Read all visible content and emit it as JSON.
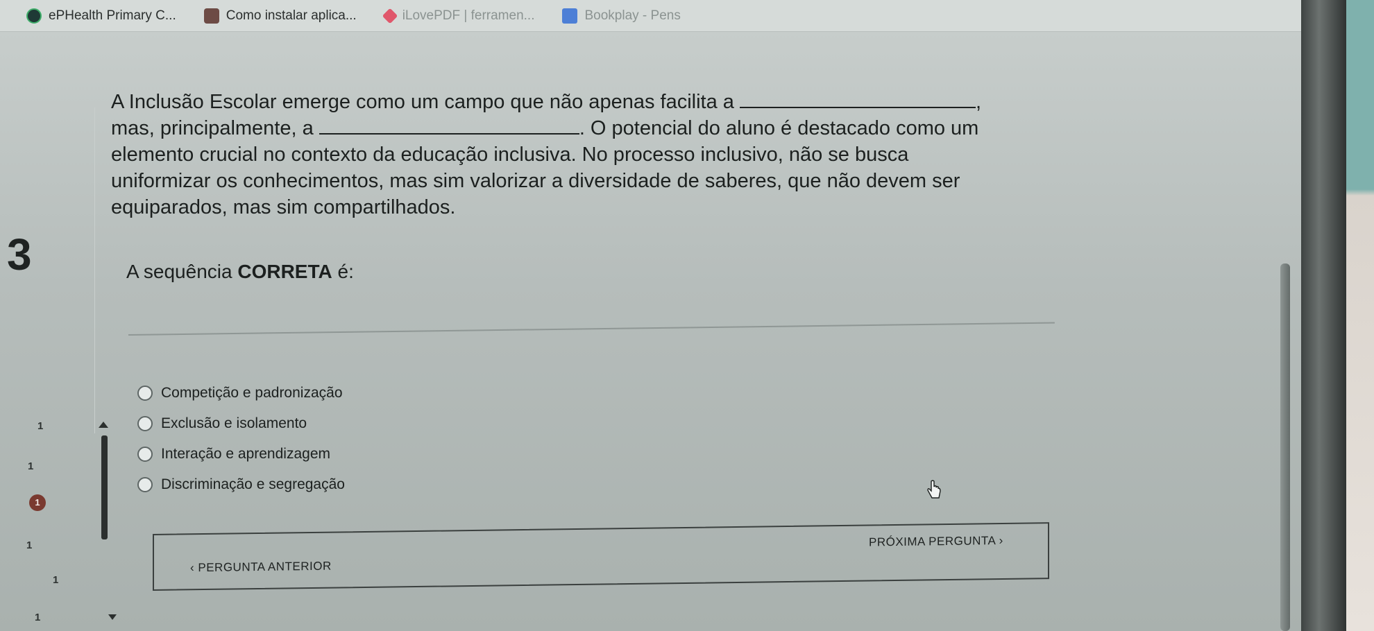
{
  "bookmarks": [
    {
      "label": "ePHealth Primary C...",
      "icon": "ephealth-icon"
    },
    {
      "label": "Como instalar aplica...",
      "icon": "como-icon"
    },
    {
      "label": "iLovePDF | ferramen...",
      "icon": "ilovepdf-icon"
    },
    {
      "label": "Bookplay - Pens",
      "icon": "bookplay-icon"
    }
  ],
  "question": {
    "number": "3",
    "line1": "A Inclusão Escolar emerge como um campo que não apenas facilita a",
    "line1_end": ",",
    "line2_start": "mas, principalmente, a",
    "line2_end": ". O potencial do aluno é destacado como um",
    "line3": "elemento crucial no contexto da educação inclusiva. No processo inclusivo, não se busca",
    "line4": "uniformizar os conhecimentos, mas sim valorizar a diversidade de saberes, que não devem ser",
    "line5": "equiparados, mas sim compartilhados.",
    "prompt_prefix": "A sequência ",
    "prompt_bold": "CORRETA",
    "prompt_suffix": " é:"
  },
  "options": [
    "Competição e padronização",
    "Exclusão e isolamento",
    "Interação e aprendizagem",
    "Discriminação e segregação"
  ],
  "sidenav": {
    "items": [
      "1",
      "1",
      "1",
      "1",
      "1",
      "1"
    ],
    "active_index": 2
  },
  "navigation": {
    "prev_label": "‹ PERGUNTA ANTERIOR",
    "next_label": "PRÓXIMA PERGUNTA ›"
  },
  "colors": {
    "active_badge": "#7a3a30",
    "text": "#1c201f"
  }
}
